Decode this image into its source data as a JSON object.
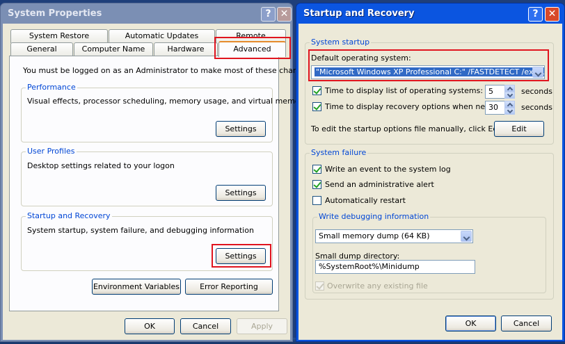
{
  "system_properties": {
    "title": "System Properties",
    "help_glyph": "?",
    "close_glyph": "✕",
    "tabs_row1": [
      "System Restore",
      "Automatic Updates",
      "Remote"
    ],
    "tabs_row2": [
      "General",
      "Computer Name",
      "Hardware",
      "Advanced"
    ],
    "admin_note": "You must be logged on as an Administrator to make most of these changes.",
    "performance": {
      "legend": "Performance",
      "desc": "Visual effects, processor scheduling, memory usage, and virtual memory",
      "button": "Settings"
    },
    "user_profiles": {
      "legend": "User Profiles",
      "desc": "Desktop settings related to your logon",
      "button": "Settings"
    },
    "startup_recovery": {
      "legend": "Startup and Recovery",
      "desc": "System startup, system failure, and debugging information",
      "button": "Settings"
    },
    "env_vars_button": "Environment Variables",
    "error_reporting_button": "Error Reporting",
    "ok": "OK",
    "cancel": "Cancel",
    "apply": "Apply"
  },
  "startup_and_recovery": {
    "title": "Startup and Recovery",
    "help_glyph": "?",
    "close_glyph": "✕",
    "system_startup": {
      "legend": "System startup",
      "default_os_label": "Default operating system:",
      "default_os_value": "\"Microsoft Windows XP Professional C:\" /FASTDETECT /execute",
      "time_list_label": "Time to display list of operating systems:",
      "time_list_checked": true,
      "time_list_value": "5",
      "time_recovery_label": "Time to display recovery options when needed:",
      "time_recovery_checked": true,
      "time_recovery_value": "30",
      "seconds_label": "seconds",
      "edit_note": "To edit the startup options file manually, click Edit.",
      "edit_button": "Edit"
    },
    "system_failure": {
      "legend": "System failure",
      "write_event_label": "Write an event to the system log",
      "write_event_checked": true,
      "send_alert_label": "Send an administrative alert",
      "send_alert_checked": true,
      "auto_restart_label": "Automatically restart",
      "auto_restart_checked": false,
      "debug_legend": "Write debugging information",
      "dump_type": "Small memory dump (64 KB)",
      "dump_dir_label": "Small dump directory:",
      "dump_dir_value": "%SystemRoot%\\Minidump",
      "overwrite_label": "Overwrite any existing file",
      "overwrite_checked": true
    },
    "ok": "OK",
    "cancel": "Cancel"
  },
  "colors": {
    "highlight_box": "#e0141e",
    "group_legend": "#0046d5",
    "active_title": "#0b55e0",
    "inactive_title": "#7b8fb4"
  }
}
